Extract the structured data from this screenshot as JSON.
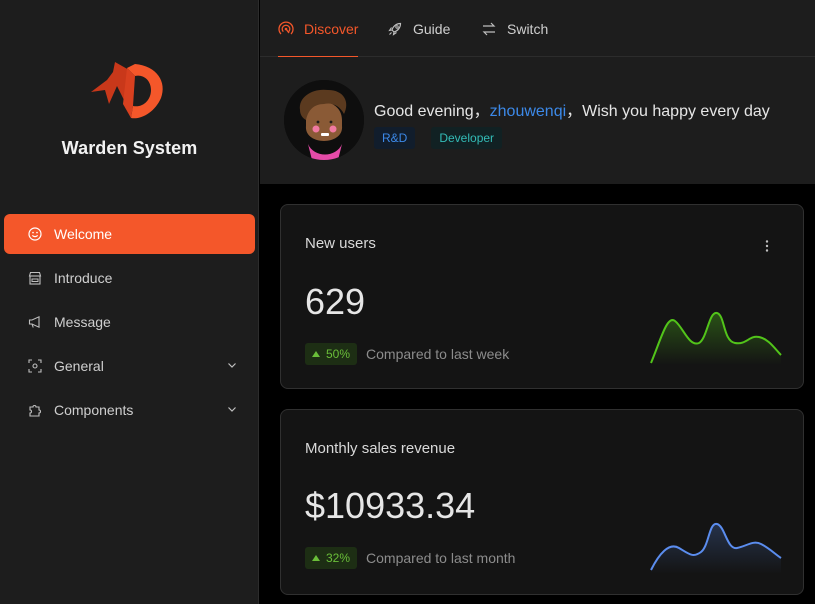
{
  "app": {
    "name": "Warden System"
  },
  "colors": {
    "accent": "#f4572a",
    "sidebar_bg": "#1d1d1d",
    "card_bg": "#141414",
    "user_link": "#3c89e8",
    "trend_up": "#6abe39",
    "spark_green": "#52c41a",
    "spark_blue": "#5b8def"
  },
  "sidebar": {
    "items": [
      {
        "label": "Welcome",
        "icon": "smile-icon",
        "active": true
      },
      {
        "label": "Introduce",
        "icon": "shop-icon"
      },
      {
        "label": "Message",
        "icon": "megaphone-icon"
      },
      {
        "label": "General",
        "icon": "scan-icon",
        "expandable": true
      },
      {
        "label": "Components",
        "icon": "puzzle-icon",
        "expandable": true
      }
    ]
  },
  "topbar": {
    "tabs": [
      {
        "label": "Discover",
        "icon": "radar-icon",
        "active": true
      },
      {
        "label": "Guide",
        "icon": "rocket-icon"
      },
      {
        "label": "Switch",
        "icon": "swap-icon"
      }
    ]
  },
  "greeting": {
    "prefix": "Good evening，",
    "username": "zhouwenqi",
    "suffix": "，Wish you happy every day",
    "tags": [
      "R&D",
      "Developer"
    ]
  },
  "cards": [
    {
      "title": "New users",
      "value": "629",
      "trend": "50%",
      "compare": "Compared to last week",
      "spark_color": "green"
    },
    {
      "title": "Monthly sales revenue",
      "value": "$10933.34",
      "trend": "32%",
      "compare": "Compared to last month",
      "spark_color": "blue"
    }
  ]
}
